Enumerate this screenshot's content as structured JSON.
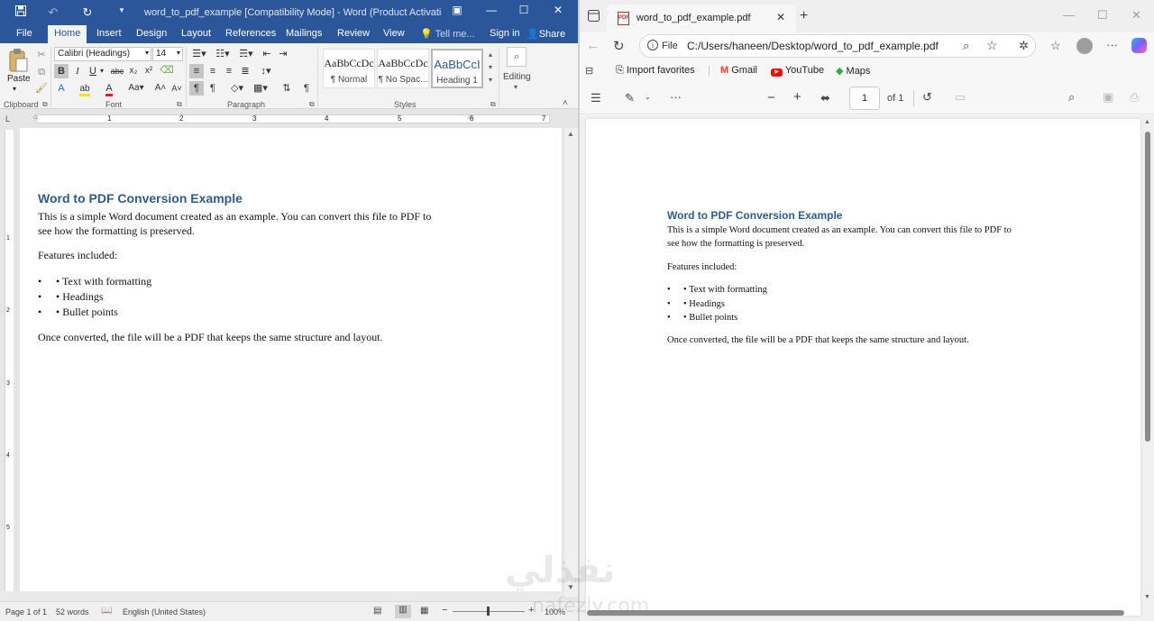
{
  "word": {
    "title": "word_to_pdf_example [Compatibility Mode] - Word (Product Activatio...",
    "tabs": [
      "File",
      "Home",
      "Insert",
      "Design",
      "Layout",
      "References",
      "Mailings",
      "Review",
      "View"
    ],
    "tell_me": "Tell me...",
    "sign_in": "Sign in",
    "share": "Share",
    "ribbon": {
      "paste": "Paste",
      "font_name": "Calibri (Headings)",
      "font_size": "14",
      "styles": [
        {
          "preview": "AaBbCcDc",
          "name": "¶ Normal"
        },
        {
          "preview": "AaBbCcDc",
          "name": "¶ No Spac..."
        },
        {
          "preview": "AaBbCcI",
          "name": "Heading 1"
        }
      ],
      "editing": "Editing",
      "groups": {
        "clipboard": "Clipboard",
        "font": "Font",
        "paragraph": "Paragraph",
        "styles": "Styles"
      }
    },
    "ruler_numbers": [
      "1",
      "1",
      "2",
      "3",
      "4",
      "5",
      "6",
      "7"
    ],
    "vruler_numbers": [
      "1",
      "2",
      "3",
      "4",
      "5"
    ],
    "status": {
      "page": "Page 1 of 1",
      "words": "52 words",
      "language": "English (United States)",
      "zoom": "100%"
    }
  },
  "document": {
    "heading": "Word to PDF Conversion Example",
    "intro_line1": "This is a simple Word document created as an example. You can convert this file to PDF to",
    "intro_line2": "see how the formatting is preserved.",
    "features_label": "Features included:",
    "bullets": [
      "• Text with formatting",
      "• Headings",
      "• Bullet points"
    ],
    "closing": "Once converted, the file will be a PDF that keeps the same structure and layout."
  },
  "edge": {
    "tab_title": "word_to_pdf_example.pdf",
    "address_scheme": "File",
    "address": "C:/Users/haneen/Desktop/word_to_pdf_example.pdf",
    "favorites": [
      "Import favorites",
      "Gmail",
      "YouTube",
      "Maps"
    ],
    "page_number": "1",
    "page_total": "of 1"
  },
  "pdf": {
    "heading": "Word to PDF Conversion Example",
    "intro_line1": "This is a simple Word document created as an example. You can convert this file to PDF to",
    "intro_line2": "see how the formatting is preserved.",
    "features_label": "Features included:",
    "bullets": [
      "• Text with formatting",
      "• Headings",
      "• Bullet points"
    ],
    "closing": "Once converted, the file will be a PDF that keeps the same structure and layout."
  },
  "watermark": {
    "arabic": "نفذلي",
    "latin": "nafezly.com"
  },
  "colors": {
    "word_blue": "#2b579a",
    "heading_blue": "#2e5c8a",
    "gmail_red": "#ea4335",
    "youtube_red": "#ff0000",
    "pdf_red": "#c1272d",
    "copilot": "#7b5cff"
  }
}
